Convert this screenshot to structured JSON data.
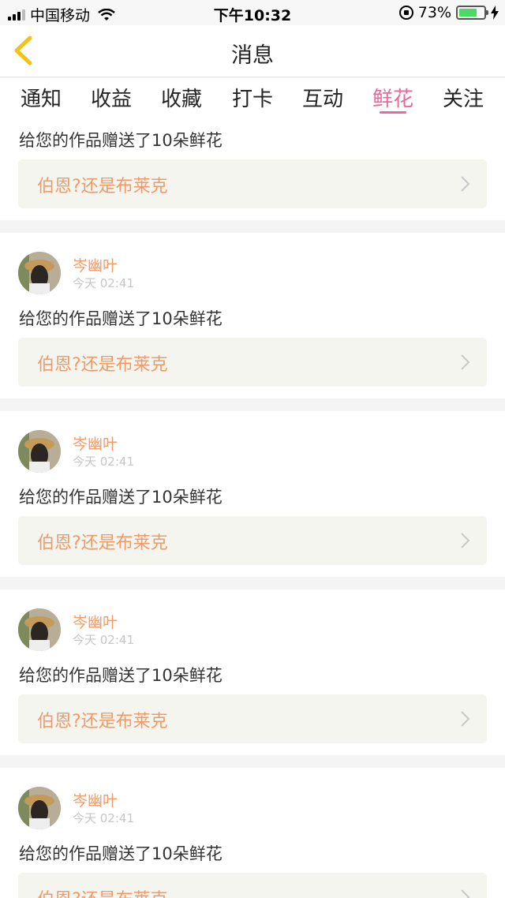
{
  "status_bar": {
    "carrier": "中国移动",
    "time": "下午10:32",
    "battery": "73%",
    "battery_level": 0.73,
    "battery_color": "#4cd964"
  },
  "nav": {
    "title": "消息",
    "back_icon": "chevron-left-icon",
    "back_color": "#f0c419"
  },
  "tabs": [
    {
      "label": "通知"
    },
    {
      "label": "收益"
    },
    {
      "label": "收藏"
    },
    {
      "label": "打卡"
    },
    {
      "label": "互动"
    },
    {
      "label": "鲜花",
      "active": true
    },
    {
      "label": "关注"
    }
  ],
  "accent_color": "#e9689a",
  "name_color": "#ef9a68",
  "items": [
    {
      "message": "给您的作品赠送了10朵鲜花",
      "work_title": "伯恩?还是布莱克"
    },
    {
      "user": "岑幽叶",
      "time": "今天 02:41",
      "message": "给您的作品赠送了10朵鲜花",
      "work_title": "伯恩?还是布莱克"
    },
    {
      "user": "岑幽叶",
      "time": "今天 02:41",
      "message": "给您的作品赠送了10朵鲜花",
      "work_title": "伯恩?还是布莱克"
    },
    {
      "user": "岑幽叶",
      "time": "今天 02:41",
      "message": "给您的作品赠送了10朵鲜花",
      "work_title": "伯恩?还是布莱克"
    },
    {
      "user": "岑幽叶",
      "time": "今天 02:41",
      "message": "给您的作品赠送了10朵鲜花",
      "work_title": "伯恩?还是布莱克"
    }
  ]
}
